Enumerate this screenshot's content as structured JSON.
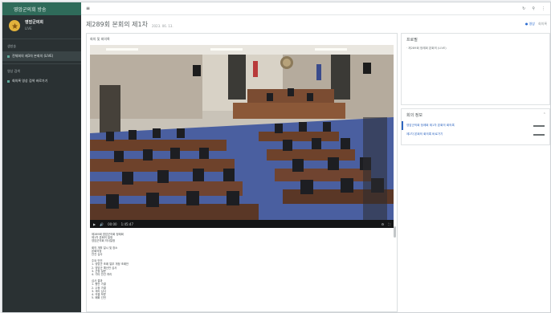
{
  "app": {
    "brand": "영암군의회 방송"
  },
  "profile": {
    "name": "영암군의회",
    "sub": "LIVE"
  },
  "sidebar": {
    "sections": [
      {
        "title": "생방송",
        "items": [
          {
            "label": "전체회의 제3차 본회의 (LIVE)",
            "active": true
          }
        ]
      },
      {
        "title": "영상 검색",
        "items": [
          {
            "label": "회의록 영상 검색 바로가기",
            "active": false
          }
        ]
      }
    ]
  },
  "topbar": {
    "menu_label": "≡",
    "tools": [
      "↻",
      "⚲",
      "⋮"
    ]
  },
  "header": {
    "title": "제289회 본회의 제1차",
    "date": "2023. 06. 13."
  },
  "view_tabs": [
    "● 영상",
    "회의록"
  ],
  "video": {
    "label": "회의 및 회의록",
    "time_current": "00:00",
    "time_total": "1:45:47",
    "controls": {
      "play_icon": "▶",
      "volume_icon": "🔊",
      "settings_icon": "⚙",
      "fullscreen_icon": "⛶"
    }
  },
  "notes": [
    [
      "제289회 영암군의회 정례회",
      "제1차 본회의 일정",
      "영암군의회 의사일정"
    ],
    [
      "회의 개최 일시 및 장소",
      "본회의장",
      "안건 심사"
    ],
    [
      "주요 안건",
      "1. 영암군 조례 일부 개정 조례안",
      "2. 영암군 예산안 심사",
      "3. 군정 질문",
      "4. 기타 안건 처리"
    ],
    [
      "심사 결과",
      "1. 원안 가결",
      "2. 수정 가결",
      "3. 계속 심사",
      "4. 의결 보류",
      "5. 폐회 선언"
    ]
  ],
  "right_top": {
    "title": "프로필",
    "item": "· 제289회 정례회 본회의 (LIVE)"
  },
  "right_bottom": {
    "title": "회의 정보",
    "rows": [
      "영암군의회 정례회 제1차 본회의 회의록",
      "제2차 본회의 회의록 바로가기"
    ]
  }
}
